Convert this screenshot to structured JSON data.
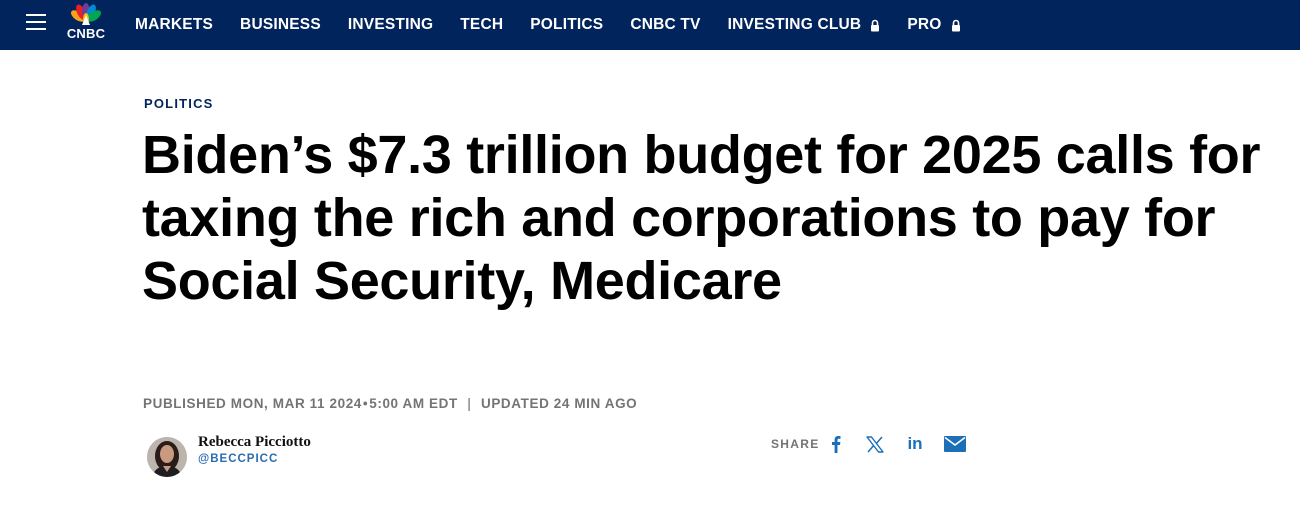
{
  "navbar": {
    "logo_text": "CNBC",
    "items": [
      {
        "label": "MARKETS",
        "locked": false
      },
      {
        "label": "BUSINESS",
        "locked": false
      },
      {
        "label": "INVESTING",
        "locked": false
      },
      {
        "label": "TECH",
        "locked": false
      },
      {
        "label": "POLITICS",
        "locked": false
      },
      {
        "label": "CNBC TV",
        "locked": false
      },
      {
        "label": "INVESTING CLUB",
        "locked": true
      },
      {
        "label": "PRO",
        "locked": true
      }
    ],
    "background_color": "#00245b",
    "hamburger_icon": "menu-icon",
    "lock_icon": "lock-icon"
  },
  "article": {
    "section": "POLITICS",
    "headline": "Biden’s $7.3 trillion budget for 2025 calls for taxing the rich and corporations to pay for Social Security, Medicare",
    "published": "PUBLISHED MON, MAR 11 2024",
    "published_time": "5:00 AM EDT",
    "updated": "UPDATED 24 MIN AGO",
    "timestamp_dot": "•",
    "timestamp_separator": "|"
  },
  "author": {
    "name": "Rebecca Picciotto",
    "handle": "@BECCPICC"
  },
  "share": {
    "label": "SHARE",
    "icons": [
      "facebook-icon",
      "x-icon",
      "linkedin-icon",
      "mail-icon"
    ],
    "linkedin_text": "in",
    "icon_color": "#1d6fb8"
  }
}
